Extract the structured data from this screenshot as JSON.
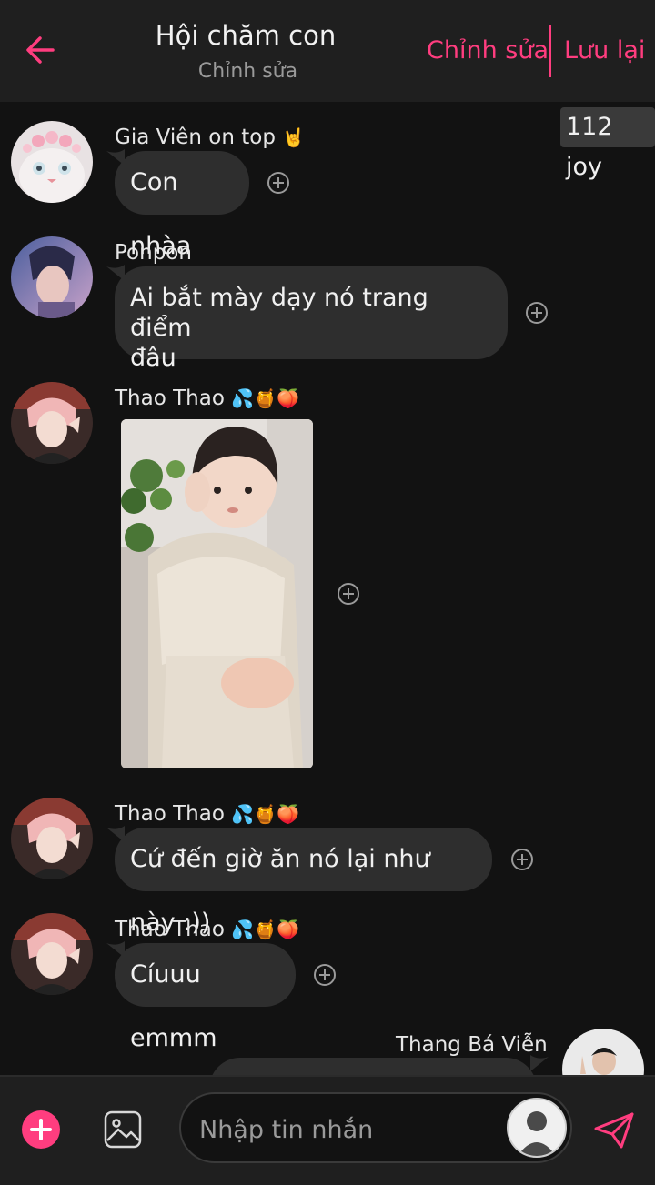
{
  "header": {
    "title": "Hội chăm con",
    "subtitle": "Chỉnh sửa",
    "edit_label": "Chỉnh sửa",
    "save_label": "Lưu lại"
  },
  "joy_badge": "112 joy",
  "messages": [
    {
      "sender": "Gia Viên on top",
      "sender_emoji": "🤘",
      "text": "Con nhàa"
    },
    {
      "sender": "Ponpon",
      "text_lines": [
        "Ai bắt mày dạy nó trang điểm",
        "đâu"
      ]
    },
    {
      "sender": "Thao Thao",
      "sender_emoji": "💦🍯🍑",
      "image": "photo-of-child"
    },
    {
      "sender": "Thao Thao",
      "sender_emoji": "💦🍯🍑",
      "text": "Cứ đến giờ ăn nó lại như này :))"
    },
    {
      "sender": "Thao Thao",
      "sender_emoji": "💦🍯🍑",
      "text": "Cíuuu emmm"
    },
    {
      "sender": "Thang Bá Viễn",
      "text": ""
    }
  ],
  "composer": {
    "placeholder": "Nhập tin nhắn"
  },
  "colors": {
    "accent": "#ff3d7f",
    "background": "#121212",
    "header": "#1f1f1f",
    "bubble": "#2e2e2e"
  },
  "icons": [
    "back-arrow-icon",
    "add-reaction-icon",
    "plus-icon",
    "image-icon",
    "default-avatar-icon",
    "send-icon"
  ]
}
